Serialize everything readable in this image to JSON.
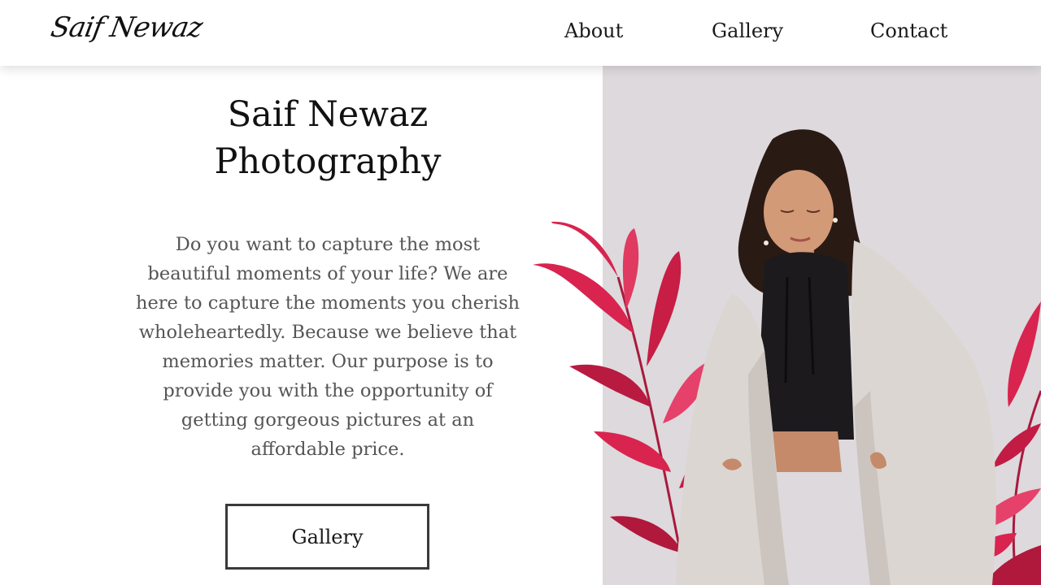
{
  "nav": {
    "logo": "Saif Newaz",
    "links": [
      "About",
      "Gallery",
      "Contact"
    ]
  },
  "hero": {
    "title_line1": "Saif Newaz",
    "title_line2": "Photography",
    "description": "Do you want to capture the most beautiful moments of your life? We are here to capture the moments you cherish wholeheartedly. Because we believe that memories matter. Our purpose is to provide you with the opportunity of getting gorgeous pictures at an affordable price.",
    "button_label": "Gallery"
  },
  "colors": {
    "background": "#ffffff",
    "photo_background": "#ddd9dd",
    "leaf_red": "#d8244f",
    "jacket": "#dcd6d2",
    "hoodie": "#1c1a1c"
  }
}
